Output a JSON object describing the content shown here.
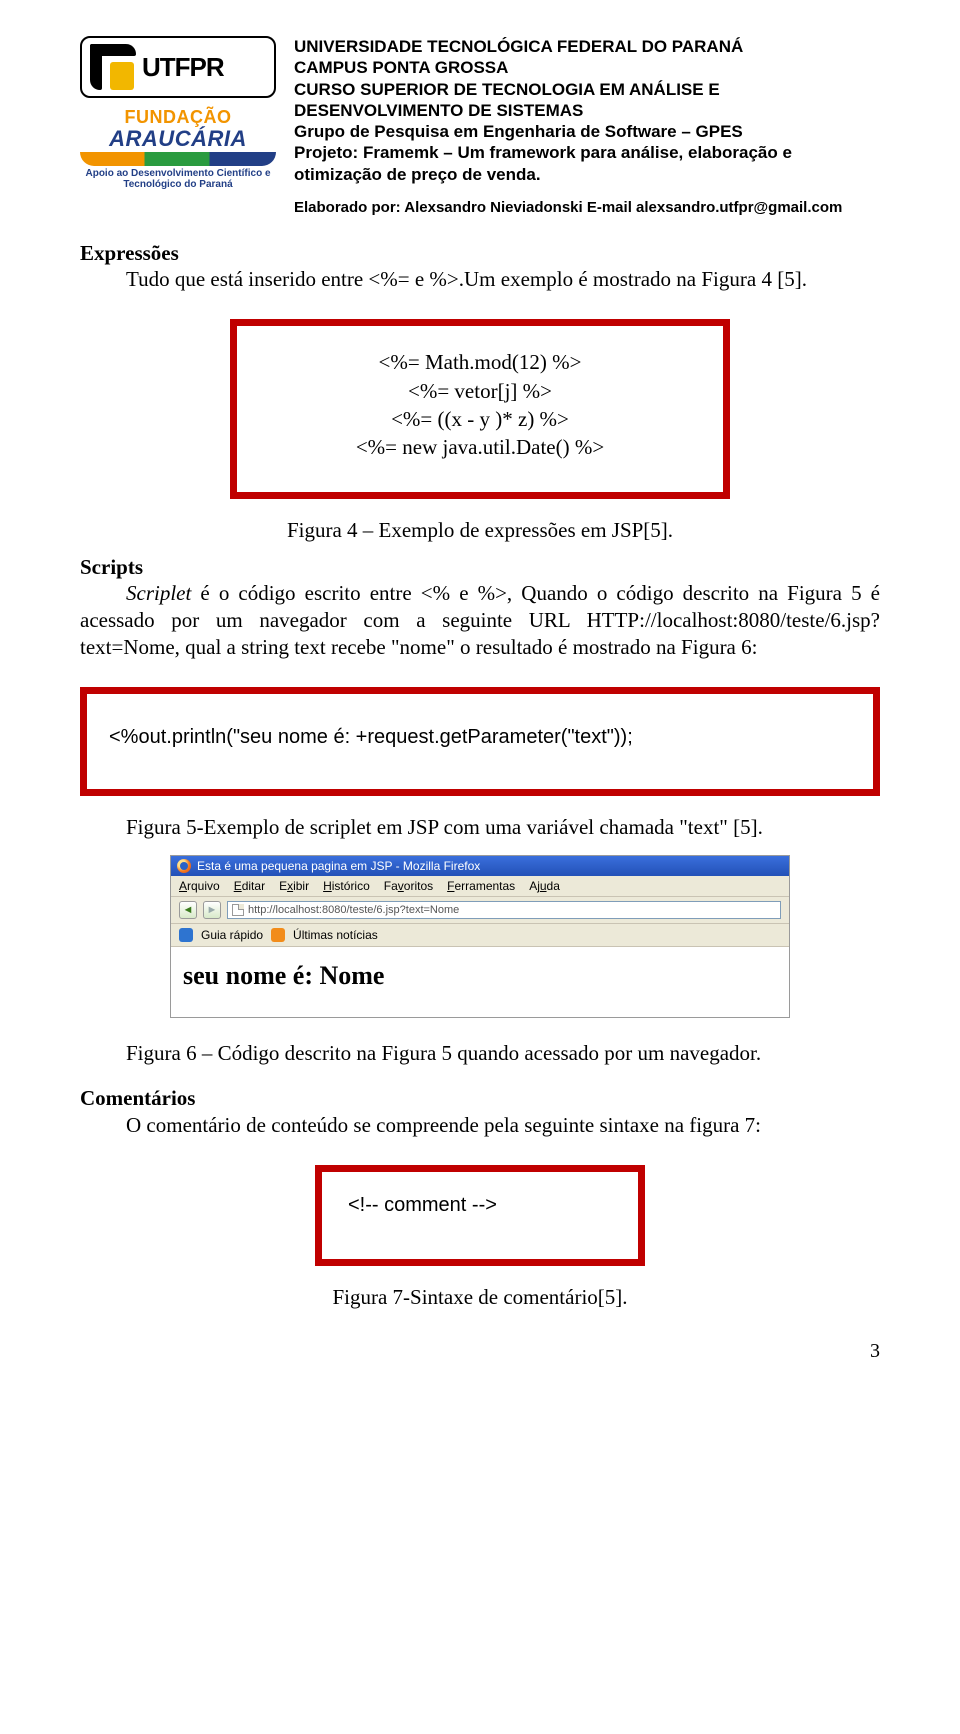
{
  "logos": {
    "utfpr_text": "UTFPR",
    "araucaria_line1": "FUNDAÇÃO",
    "araucaria_line2": "ARAUCÁRIA",
    "araucaria_sub": "Apoio ao Desenvolvimento Científico e Tecnológico do Paraná"
  },
  "header": {
    "l1": "UNIVERSIDADE TECNOLÓGICA FEDERAL DO PARANÁ",
    "l2": "CAMPUS PONTA GROSSA",
    "l3": "CURSO SUPERIOR DE TECNOLOGIA EM ANÁLISE E DESENVOLVIMENTO DE SISTEMAS",
    "l4": "Grupo de Pesquisa em Engenharia de Software – GPES",
    "l5": "Projeto: Framemk – Um framework para análise, elaboração e otimização de preço de venda.",
    "author": "Elaborado por: Alexsandro Nieviadonski E-mail alexsandro.utfpr@gmail.com"
  },
  "s_expressoes": {
    "title": "Expressões",
    "p1": "Tudo que está inserido entre <%= e %>.Um exemplo é mostrado na Figura 4 [5].",
    "code": {
      "l1": "<%= Math.mod(12) %>",
      "l2": "<%= vetor[j] %>",
      "l3": "<%= ((x - y )* z) %>",
      "l4": "<%= new java.util.Date() %>"
    },
    "caption": "Figura 4 – Exemplo de expressões em JSP[5]."
  },
  "s_scripts": {
    "title": "Scripts",
    "p1_a": "Scriplet ",
    "p1_b": "é o código escrito entre <% e %>, Quando o código descrito na Figura 5 é acessado por um navegador com a seguinte URL HTTP://localhost:8080/teste/6.jsp?text=Nome, qual a string text recebe \"nome\" o resultado é mostrado na Figura 6:",
    "code_line": "<%out.println(\"seu nome é: +request.getParameter(\"text\"));",
    "caption5": "Figura 5-Exemplo de scriplet em JSP com uma variável chamada \"text\" [5].",
    "caption6": "Figura 6 – Código descrito na Figura 5 quando acessado por um navegador."
  },
  "browser": {
    "title": "Esta é uma pequena pagina em JSP - Mozilla Firefox",
    "menu": {
      "arquivo": "Arquivo",
      "editar": "Editar",
      "exibir": "Exibir",
      "historico": "Histórico",
      "favoritos": "Favoritos",
      "ferramentas": "Ferramentas",
      "ajuda": "Ajuda"
    },
    "url": "http://localhost:8080/teste/6.jsp?text=Nome",
    "bookmarks": {
      "guia": "Guia rápido",
      "noticias": "Últimas notícias"
    },
    "content_line": "seu nome é: Nome"
  },
  "s_comentarios": {
    "title": "Comentários",
    "p1": "O comentário de conteúdo se compreende pela seguinte sintaxe na figura 7:",
    "code_line": "<!-- comment -->",
    "caption7": "Figura 7-Sintaxe de comentário[5]."
  },
  "page_number": "3"
}
